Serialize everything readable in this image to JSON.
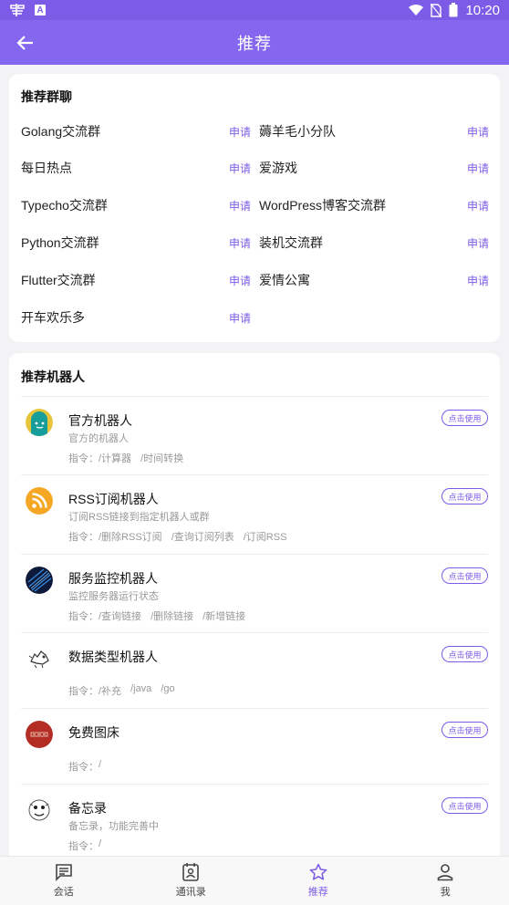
{
  "status_bar": {
    "time": "10:20"
  },
  "app_bar": {
    "title": "推荐"
  },
  "groups_section": {
    "title": "推荐群聊",
    "apply_label": "申请",
    "items": [
      {
        "name": "Golang交流群"
      },
      {
        "name": "薅羊毛小分队"
      },
      {
        "name": "每日热点"
      },
      {
        "name": "爱游戏"
      },
      {
        "name": "Typecho交流群"
      },
      {
        "name": "WordPress博客交流群"
      },
      {
        "name": "Python交流群"
      },
      {
        "name": "装机交流群"
      },
      {
        "name": "Flutter交流群"
      },
      {
        "name": "爱情公寓"
      },
      {
        "name": "开车欢乐多"
      }
    ]
  },
  "bots_section": {
    "title": "推荐机器人",
    "use_label": "点击使用",
    "cmd_prefix": "指令：",
    "items": [
      {
        "name": "官方机器人",
        "desc": "官方的机器人",
        "cmds": [
          "/计算器",
          "/时间转换"
        ],
        "avatar": "robot-face"
      },
      {
        "name": "RSS订阅机器人",
        "desc": "订阅RSS链接到指定机器人或群",
        "cmds": [
          "/删除RSS订阅",
          "/查询订阅列表",
          "/订阅RSS"
        ],
        "avatar": "rss"
      },
      {
        "name": "服务监控机器人",
        "desc": "监控服务器运行状态",
        "cmds": [
          "/查询链接",
          "/删除链接",
          "/新增链接"
        ],
        "avatar": "monitor"
      },
      {
        "name": "数据类型机器人",
        "desc": "",
        "cmds": [
          "/补充",
          "/java",
          "/go"
        ],
        "avatar": "sketch"
      },
      {
        "name": "免费图床",
        "desc": "",
        "cmds": [
          "/"
        ],
        "avatar": "red-logo"
      },
      {
        "name": "备忘录",
        "desc": "备忘录，功能完善中",
        "cmds": [
          "/"
        ],
        "avatar": "memo"
      }
    ]
  },
  "bottom_nav": {
    "items": [
      {
        "label": "会话",
        "icon": "chat-icon"
      },
      {
        "label": "通讯录",
        "icon": "contacts-icon"
      },
      {
        "label": "推荐",
        "icon": "star-icon"
      },
      {
        "label": "我",
        "icon": "person-icon"
      }
    ]
  },
  "colors": {
    "primary": "#8467ee",
    "accent": "#7c5ce6"
  }
}
